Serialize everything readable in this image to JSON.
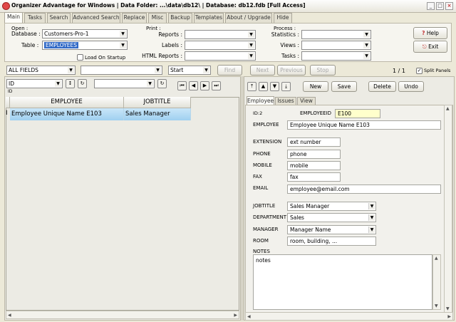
{
  "window": {
    "title": "Organizer Advantage for Windows | Data Folder: ...\\data\\db12\\ | Database: db12.fdb [Full Access]"
  },
  "tabs": [
    "Main",
    "Tasks",
    "Search",
    "Advanced Search",
    "Replace",
    "Misc",
    "Backup",
    "Templates",
    "About / Upgrade",
    "Hide"
  ],
  "open": {
    "header": "Open :",
    "database_label": "Database :",
    "database_value": "Customers-Pro-1",
    "table_label": "Table :",
    "table_value": "EMPLOYEES",
    "load_on_startup": "Load On Startup"
  },
  "print": {
    "header": "Print :",
    "reports": "Reports :",
    "labels": "Labels :",
    "html_reports": "HTML Reports :"
  },
  "process": {
    "header": "Process :",
    "statistics": "Statistics :",
    "views": "Views :",
    "tasks": "Tasks :"
  },
  "help": {
    "help": "Help",
    "exit": "Exit"
  },
  "search": {
    "field": "ALL FIELDS",
    "mode": "Start",
    "find": "Find",
    "next": "Next",
    "previous": "Previous",
    "stop": "Stop",
    "record_count": "1 / 1",
    "split_panels": "Split Panels"
  },
  "sort": {
    "field": "ID",
    "field_caption": "ID"
  },
  "grid": {
    "columns": [
      "EMPLOYEE",
      "JOBTITLE"
    ],
    "row_indicator": "I",
    "rows": [
      {
        "employee": "Employee Unique Name E103",
        "jobtitle": "Sales Manager"
      }
    ]
  },
  "record_buttons": {
    "new": "New",
    "save": "Save",
    "delete": "Delete",
    "undo": "Undo"
  },
  "form_tabs": [
    "Employee",
    "Issues",
    "View"
  ],
  "form": {
    "id_label": "ID:2",
    "employeeid_label": "EMPLOYEEID",
    "employeeid": "E100",
    "employee_label": "EMPLOYEE",
    "employee": "Employee Unique Name E103",
    "extension_label": "EXTENSION",
    "extension": "ext number",
    "phone_label": "PHONE",
    "phone": "phone",
    "mobile_label": "MOBILE",
    "mobile": "mobile",
    "fax_label": "FAX",
    "fax": "fax",
    "email_label": "EMAIL",
    "email": "employee@email.com",
    "jobtitle_label": "JOBTITLE",
    "jobtitle": "Sales Manager",
    "department_label": "DEPARTMENT",
    "department": "Sales",
    "manager_label": "MANAGER",
    "manager": "Manager Name",
    "room_label": "ROOM",
    "room": "room, building, ...",
    "notes_label": "NOTES",
    "notes": "notes"
  },
  "colors": {
    "selection": "#3169c6",
    "row_highlight": "#a8d6f3",
    "id_field": "#ffffcc"
  }
}
